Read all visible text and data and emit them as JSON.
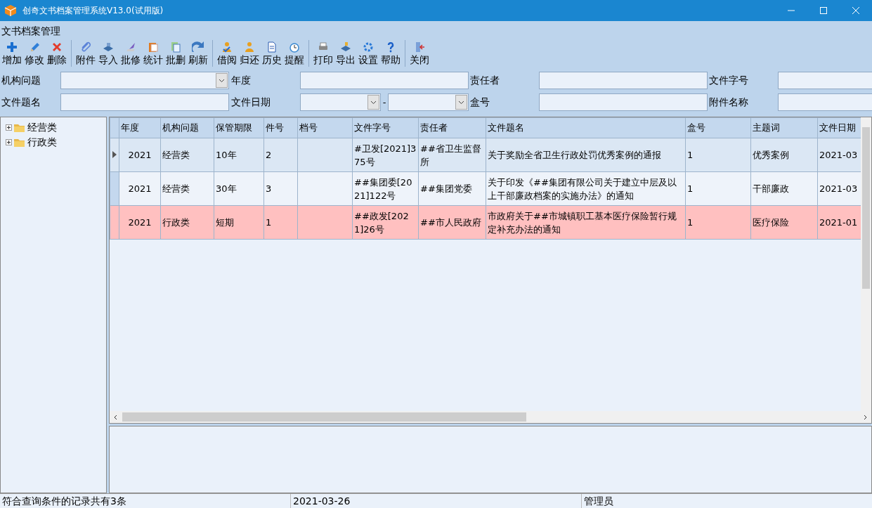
{
  "window": {
    "title": "创奇文书档案管理系统V13.0(试用版)"
  },
  "menu": {
    "label": "文书档案管理"
  },
  "toolbar": [
    [
      {
        "label": "增加"
      },
      {
        "label": "修改"
      },
      {
        "label": "删除"
      }
    ],
    [
      {
        "label": "附件"
      },
      {
        "label": "导入"
      },
      {
        "label": "批修"
      },
      {
        "label": "统计"
      },
      {
        "label": "批删"
      },
      {
        "label": "刷新"
      }
    ],
    [
      {
        "label": "借阅"
      },
      {
        "label": "归还"
      },
      {
        "label": "历史"
      },
      {
        "label": "提醒"
      }
    ],
    [
      {
        "label": "打印"
      },
      {
        "label": "导出"
      },
      {
        "label": "设置"
      },
      {
        "label": "帮助"
      }
    ],
    [
      {
        "label": "关闭"
      }
    ]
  ],
  "filters": [
    [
      {
        "label": "机构问题",
        "kind": "combo"
      },
      {
        "label": "年度",
        "kind": "text"
      },
      {
        "label": "责任者",
        "kind": "text"
      },
      {
        "label": "文件字号",
        "kind": "text"
      }
    ],
    [
      {
        "label": "文件题名",
        "kind": "text"
      },
      {
        "label": "文件日期",
        "kind": "daterange",
        "separator": "-"
      },
      {
        "label": "盒号",
        "kind": "text"
      },
      {
        "label": "附件名称",
        "kind": "text"
      }
    ]
  ],
  "tree": [
    {
      "label": "经营类",
      "expanded": false
    },
    {
      "label": "行政类",
      "expanded": false
    }
  ],
  "table": {
    "columns": [
      "年度",
      "机构问题",
      "保管期限",
      "件号",
      "档号",
      "文件字号",
      "责任者",
      "文件题名",
      "盒号",
      "主题词",
      "文件日期"
    ],
    "rows": [
      {
        "selected": true,
        "highlighted": false,
        "cells": [
          "2021",
          "经营类",
          "10年",
          "2",
          "",
          "#卫发[2021]375号",
          "##省卫生监督所",
          "关于奖励全省卫生行政处罚优秀案例的通报",
          "1",
          "优秀案例",
          "2021-03"
        ]
      },
      {
        "selected": false,
        "highlighted": false,
        "cells": [
          "2021",
          "经营类",
          "30年",
          "3",
          "",
          "##集团委[2021]122号",
          "##集团党委",
          "关于印发《##集团有限公司关于建立中层及以上干部廉政档案的实施办法》的通知",
          "1",
          "干部廉政",
          "2021-03"
        ]
      },
      {
        "selected": false,
        "highlighted": true,
        "cells": [
          "2021",
          "行政类",
          "短期",
          "1",
          "",
          "##政发[2021]26号",
          "##市人民政府",
          "市政府关于##市城镇职工基本医疗保险暂行规定补充办法的通知",
          "1",
          "医疗保险",
          "2021-01"
        ]
      }
    ]
  },
  "status_bar": [
    "符合查询条件的记录共有3条",
    "2021-03-26",
    "管理员"
  ]
}
